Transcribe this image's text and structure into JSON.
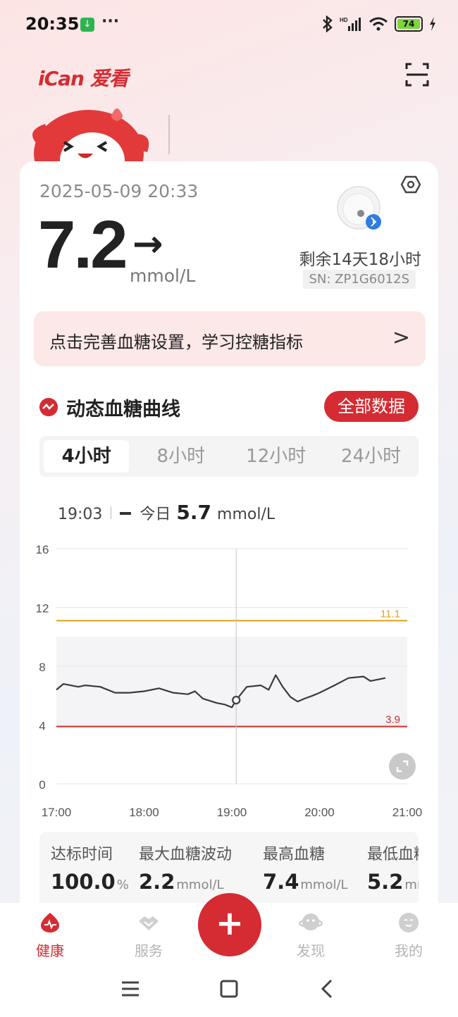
{
  "status_bar": {
    "time": "20:35",
    "dots": "···",
    "battery": "74"
  },
  "header": {
    "logo": "iCan 爱看"
  },
  "reading": {
    "datetime": "2025-05-09 20:33",
    "value": "7.2",
    "trend": "→",
    "unit": "mmol/L",
    "remaining": "剩余14天18小时",
    "sn": "SN: ZP1G6012S"
  },
  "banner": {
    "text": "点击完善血糖设置，学习控糖指标",
    "chevron": ">"
  },
  "section": {
    "title": "动态血糖曲线",
    "all_data_button": "全部数据"
  },
  "tabs": [
    {
      "label": "4小时",
      "active": true
    },
    {
      "label": "8小时",
      "active": false
    },
    {
      "label": "12小时",
      "active": false
    },
    {
      "label": "24小时",
      "active": false
    }
  ],
  "readout": {
    "time": "19:03",
    "series": "今日",
    "value": "5.7",
    "unit": "mmol/L"
  },
  "chart_data": {
    "type": "line",
    "ylim": [
      0,
      16
    ],
    "yticks": [
      "0",
      "4",
      "8",
      "12",
      "16"
    ],
    "xticks": [
      "17:00",
      "18:00",
      "19:00",
      "20:00",
      "21:00"
    ],
    "target_range": [
      3.9,
      10
    ],
    "high_line": {
      "value": 11.1,
      "label": "11.1",
      "color": "#e0a020"
    },
    "low_line": {
      "value": 3.9,
      "label": "3.9",
      "color": "#c9302c"
    },
    "cursor": {
      "x": 19.05,
      "y": 5.7
    },
    "series": [
      {
        "x": [
          17.0,
          17.08,
          17.25,
          17.33,
          17.5,
          17.67,
          17.83,
          18.0,
          18.17,
          18.33,
          18.5,
          18.58,
          18.67,
          18.83,
          18.92,
          19.0,
          19.05,
          19.17,
          19.33,
          19.42,
          19.5,
          19.58,
          19.67,
          19.75,
          19.83,
          19.92,
          20.0,
          20.17,
          20.33,
          20.5,
          20.58,
          20.75
        ],
        "y": [
          6.4,
          6.8,
          6.6,
          6.7,
          6.6,
          6.2,
          6.2,
          6.3,
          6.5,
          6.2,
          6.1,
          6.3,
          5.8,
          5.5,
          5.4,
          5.2,
          5.7,
          6.6,
          6.7,
          6.4,
          7.4,
          6.6,
          5.9,
          5.6,
          5.8,
          6.0,
          6.2,
          6.7,
          7.2,
          7.3,
          7.0,
          7.2
        ]
      }
    ]
  },
  "stats": [
    {
      "label": "达标时间",
      "value": "100.0",
      "unit": "%"
    },
    {
      "label": "最大血糖波动",
      "value": "2.2",
      "unit": "mmol/L"
    },
    {
      "label": "最高血糖",
      "value": "7.4",
      "unit": "mmol/L"
    },
    {
      "label": "最低血糖",
      "value": "5.2",
      "unit": "mmol/L"
    }
  ],
  "bottom_nav": [
    {
      "label": "健康",
      "icon": "heart-pulse-icon",
      "active": true
    },
    {
      "label": "服务",
      "icon": "handshake-icon",
      "active": false
    },
    {
      "label": "发现",
      "icon": "planet-icon",
      "active": false
    },
    {
      "label": "我的",
      "icon": "profile-face-icon",
      "active": false
    }
  ],
  "fab": {
    "label": "+"
  },
  "colors": {
    "accent": "#d52b32",
    "banner_bg": "#fde8e8"
  }
}
